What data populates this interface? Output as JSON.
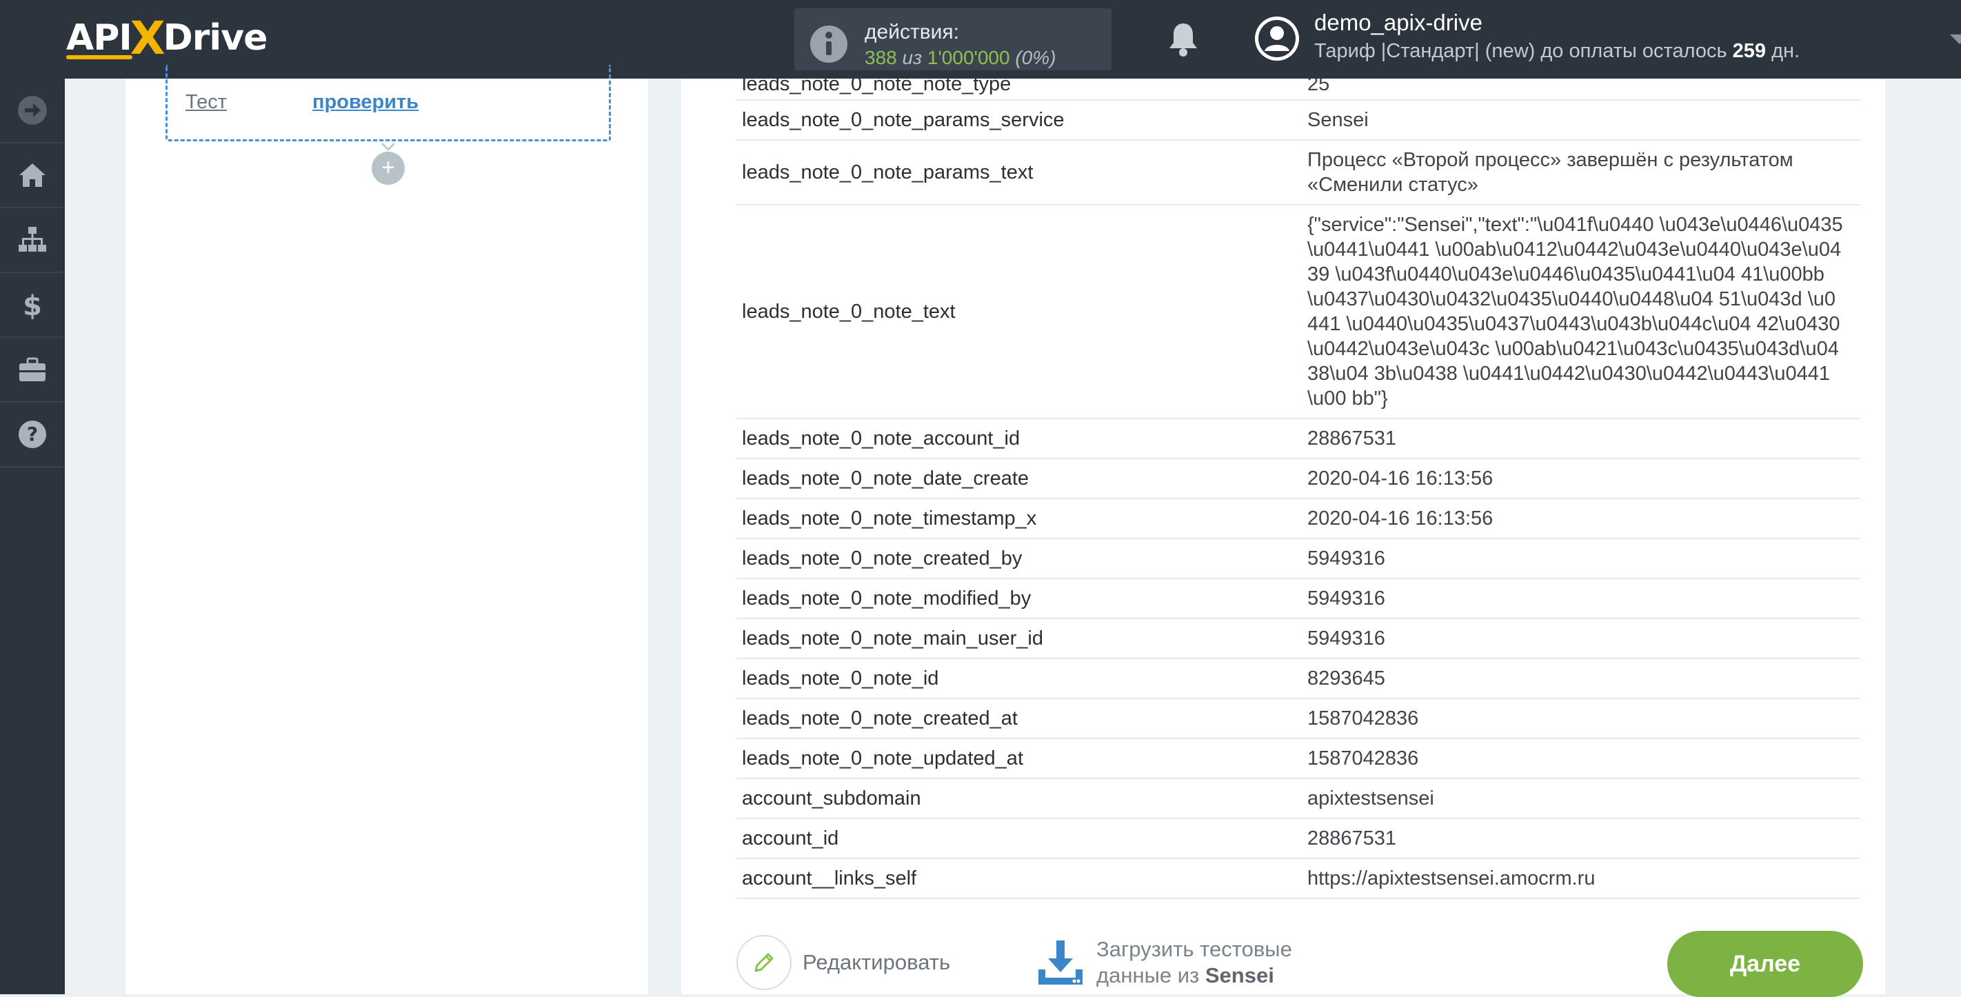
{
  "header": {
    "logo": {
      "api": "API",
      "x": "X",
      "drive": "Drive"
    },
    "actions": {
      "label": "действия:",
      "used": "388",
      "of": "из",
      "limit": "1'000'000",
      "percent": "(0%)"
    },
    "user": {
      "name": "demo_apix-drive",
      "tariff_prefix": "Тариф |Стандарт| (new) до оплаты осталось",
      "days": "259",
      "days_suffix": "дн."
    }
  },
  "sidebar": {
    "items": [
      {
        "icon": "arrow-right-circle-icon"
      },
      {
        "icon": "home-icon"
      },
      {
        "icon": "sitemap-icon"
      },
      {
        "icon": "dollar-icon"
      },
      {
        "icon": "briefcase-icon"
      },
      {
        "icon": "help-icon"
      }
    ]
  },
  "left_panel": {
    "test_label": "Тест",
    "check_link": "проверить",
    "add_icon": "+"
  },
  "table": {
    "partial_row": {
      "key": "leads_note_0_note_note_type",
      "value": "25"
    },
    "rows": [
      {
        "key": "leads_note_0_note_params_service",
        "value": "Sensei"
      },
      {
        "key": "leads_note_0_note_params_text",
        "value": "Процесс «Второй процесс» завершён с результатом «Сменили статус»"
      },
      {
        "key": "leads_note_0_note_text",
        "value": "{\"service\":\"Sensei\",\"text\":\"\\u041f\\u0440 \\u043e\\u0446\\u0435\\u0441\\u0441 \\u00ab\\u0412\\u0442\\u043e\\u0440\\u043e\\u04 39 \\u043f\\u0440\\u043e\\u0446\\u0435\\u0441\\u04 41\\u00bb \\u0437\\u0430\\u0432\\u0435\\u0440\\u0448\\u04 51\\u043d \\u0441 \\u0440\\u0435\\u0437\\u0443\\u043b\\u044c\\u04 42\\u0430\\u0442\\u043e\\u043c \\u00ab\\u0421\\u043c\\u0435\\u043d\\u0438\\u04 3b\\u0438 \\u0441\\u0442\\u0430\\u0442\\u0443\\u0441\\u00 bb\"}"
      },
      {
        "key": "leads_note_0_note_account_id",
        "value": "28867531"
      },
      {
        "key": "leads_note_0_note_date_create",
        "value": "2020-04-16 16:13:56"
      },
      {
        "key": "leads_note_0_note_timestamp_x",
        "value": "2020-04-16 16:13:56"
      },
      {
        "key": "leads_note_0_note_created_by",
        "value": "5949316"
      },
      {
        "key": "leads_note_0_note_modified_by",
        "value": "5949316"
      },
      {
        "key": "leads_note_0_note_main_user_id",
        "value": "5949316"
      },
      {
        "key": "leads_note_0_note_id",
        "value": "8293645"
      },
      {
        "key": "leads_note_0_note_created_at",
        "value": "1587042836"
      },
      {
        "key": "leads_note_0_note_updated_at",
        "value": "1587042836"
      },
      {
        "key": "account_subdomain",
        "value": "apixtestsensei"
      },
      {
        "key": "account_id",
        "value": "28867531"
      },
      {
        "key": "account__links_self",
        "value": "https://apixtestsensei.amocrm.ru"
      }
    ]
  },
  "footer": {
    "edit_label": "Редактировать",
    "load_line1": "Загрузить тестовые",
    "load_line2_prefix": "данные из",
    "load_service": "Sensei",
    "next_label": "Далее"
  },
  "colors": {
    "topbar": "#2c343d",
    "accent_yellow": "#f5b400",
    "link_blue": "#3b86c8",
    "next_green": "#7cb342",
    "actions_green": "#8cc152"
  }
}
